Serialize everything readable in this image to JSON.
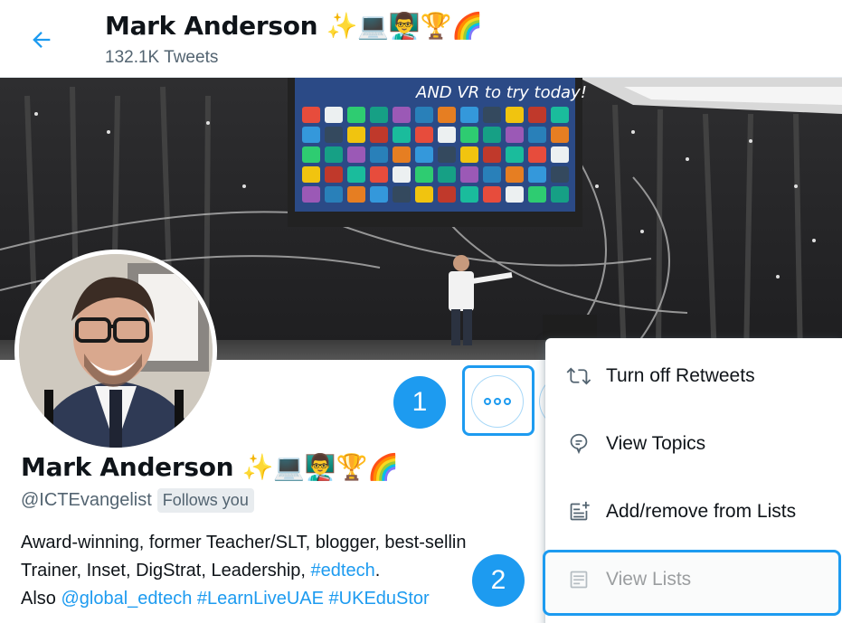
{
  "header": {
    "name": "Mark Anderson",
    "emoji": "✨💻👨‍🏫🏆🌈",
    "tweet_count": "132.1K Tweets"
  },
  "banner": {
    "screen_title": "AND VR to try today!"
  },
  "profile": {
    "name": "Mark Anderson",
    "emoji": "✨💻👨‍🏫🏆🌈",
    "handle": "@ICTEvangelist",
    "follows_you": "Follows you",
    "bio_line1": "Award-winning, former Teacher/SLT, blogger, best-sellin",
    "bio_line2_text": "Trainer, Inset, DigStrat, Leadership, ",
    "bio_line2_link": "#edtech",
    "bio_line2_end": ".",
    "bio_line3_text": "Also ",
    "bio_line3_link1": "@global_edtech",
    "bio_line3_link2": "#LearnLiveUAE",
    "bio_line3_link3": "#UKEduStor"
  },
  "callouts": {
    "one": "1",
    "two": "2"
  },
  "menu": {
    "items": [
      {
        "label": "Turn off Retweets",
        "icon": "retweet-icon"
      },
      {
        "label": "View Topics",
        "icon": "topic-icon"
      },
      {
        "label": "Add/remove from Lists",
        "icon": "list-add-icon"
      },
      {
        "label": "View Lists",
        "icon": "list-icon"
      }
    ]
  },
  "colors": {
    "accent": "#1d9bf0",
    "secondary_text": "#536471",
    "primary_text": "#0f1419"
  }
}
